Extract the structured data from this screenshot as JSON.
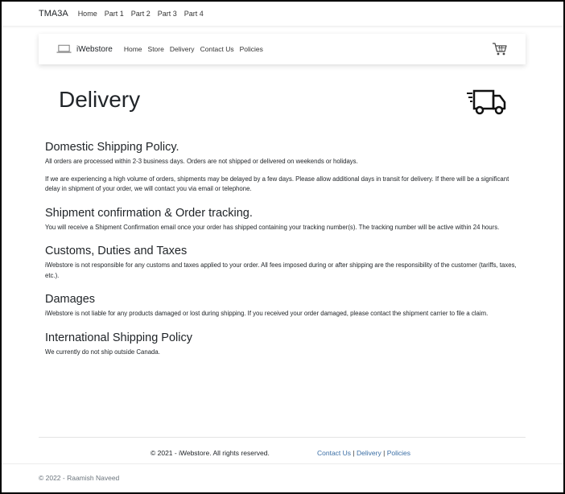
{
  "topnav": {
    "brand": "TMA3A",
    "links": [
      "Home",
      "Part 1",
      "Part 2",
      "Part 3",
      "Part 4"
    ]
  },
  "sitenav": {
    "brand": "iWebstore",
    "links": [
      "Home",
      "Store",
      "Delivery",
      "Contact Us",
      "Policies"
    ],
    "cart_icon": "cart-icon",
    "logo_icon": "laptop-icon"
  },
  "page": {
    "title": "Delivery",
    "hero_icon": "truck-icon"
  },
  "sections": [
    {
      "heading": "Domestic Shipping Policy.",
      "paragraphs": [
        "All orders are processed within 2-3 business days. Orders are not shipped or delivered on weekends or holidays.",
        "If we are experiencing a high volume of orders, shipments may be delayed by a few days. Please allow additional days in transit for delivery. If there will be a significant delay in shipment of your order, we will contact you via email or telephone."
      ]
    },
    {
      "heading": "Shipment confirmation & Order tracking.",
      "paragraphs": [
        "You will receive a Shipment Confirmation email once your order has shipped containing your tracking number(s). The tracking number will be active within 24 hours."
      ]
    },
    {
      "heading": "Customs, Duties and Taxes",
      "paragraphs": [
        "iWebstore is not responsible for any customs and taxes applied to your order. All fees imposed during or after shipping are the responsibility of the customer (tariffs, taxes, etc.)."
      ]
    },
    {
      "heading": "Damages",
      "paragraphs": [
        "iWebstore is not liable for any products damaged or lost during shipping. If you received your order damaged, please contact the shipment carrier to file a claim."
      ]
    },
    {
      "heading": "International Shipping Policy",
      "paragraphs": [
        "We currently do not ship outside Canada."
      ]
    }
  ],
  "footer": {
    "copyright": "© 2021 - iWebstore. All rights reserved.",
    "links": [
      "Contact Us",
      "Delivery",
      "Policies"
    ],
    "separator": "|",
    "link_color": "#3a6ea5"
  },
  "credit": "© 2022 - Raamish Naveed"
}
